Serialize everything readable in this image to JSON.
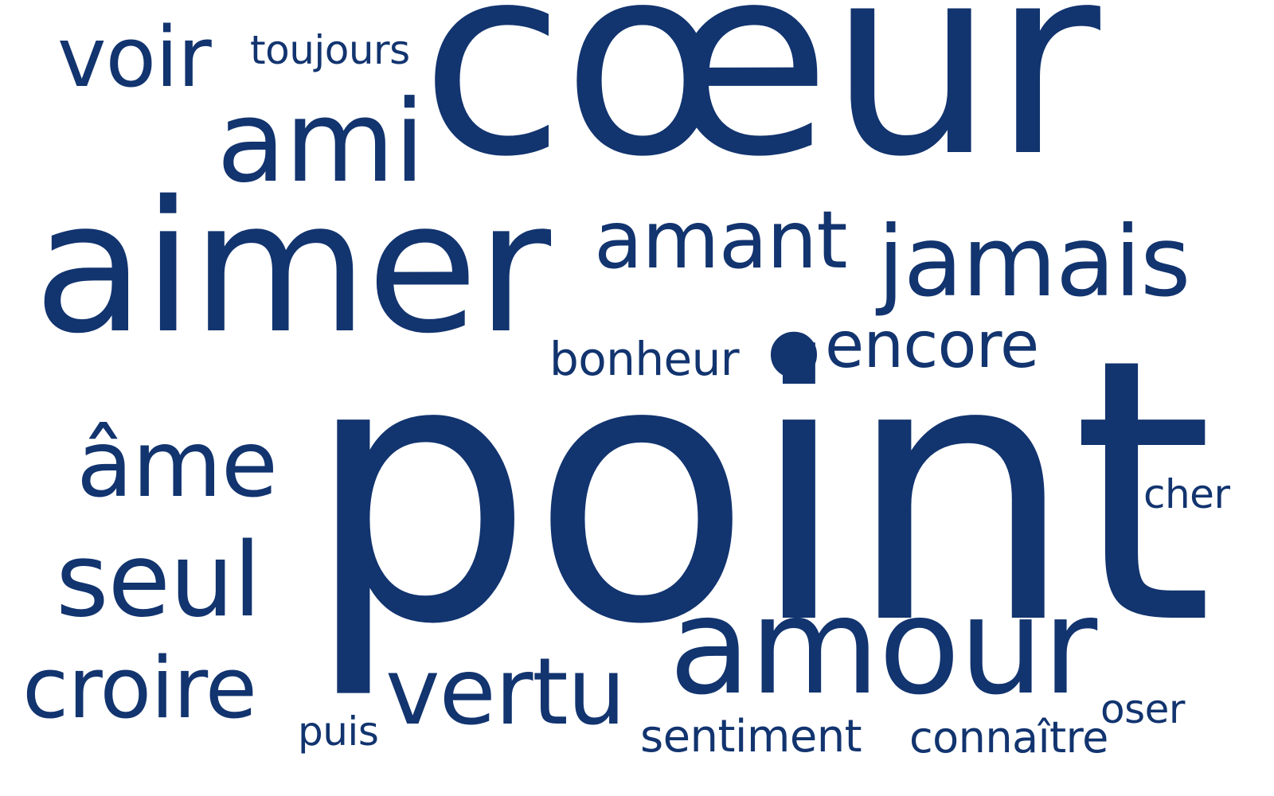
{
  "colors": {
    "word": "#12346f",
    "background": "#ffffff"
  },
  "words": {
    "coeur": "cœur",
    "point": "point",
    "aimer": "aimer",
    "amour": "amour",
    "jamais": "jamais",
    "amant": "amant",
    "ami": "ami",
    "voir": "voir",
    "toujours": "toujours",
    "ame": "âme",
    "seul": "seul",
    "croire": "croire",
    "vertu": "vertu",
    "puis": "puis",
    "sentiment": "sentiment",
    "connaitre": "connaître",
    "oser": "oser",
    "cher": "cher",
    "bonheur": "bonheur",
    "encore": "encore",
    "dot": "•"
  }
}
